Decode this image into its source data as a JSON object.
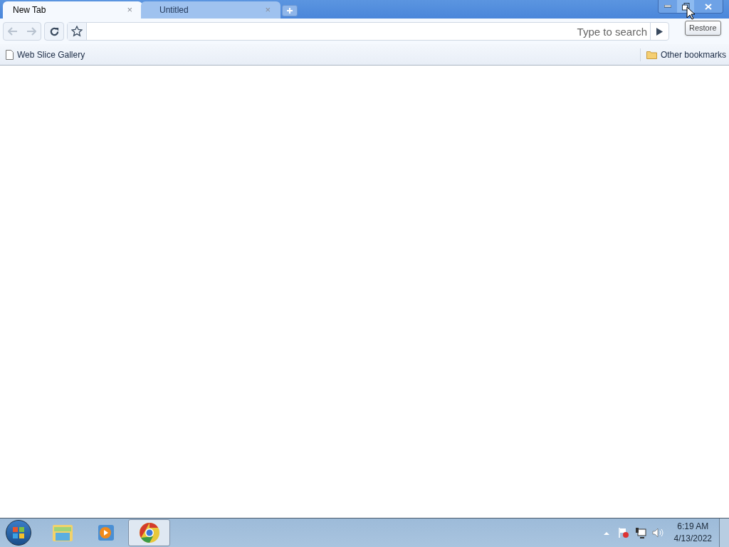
{
  "tabs": [
    {
      "label": "New Tab",
      "close": "×",
      "selected": true
    },
    {
      "label": "Untitled",
      "close": "×",
      "selected": false
    }
  ],
  "address_bar": {
    "placeholder": "Type to search"
  },
  "bookmarks": {
    "items": [
      "Web Slice Gallery"
    ],
    "other": "Other bookmarks"
  },
  "tooltip": "Restore",
  "taskbar": {
    "apps": [
      {
        "kind": "folder",
        "selected": false
      },
      {
        "kind": "media",
        "selected": false
      },
      {
        "kind": "browser",
        "selected": true
      }
    ],
    "time": "6:19 AM",
    "date": "4/13/2022"
  }
}
